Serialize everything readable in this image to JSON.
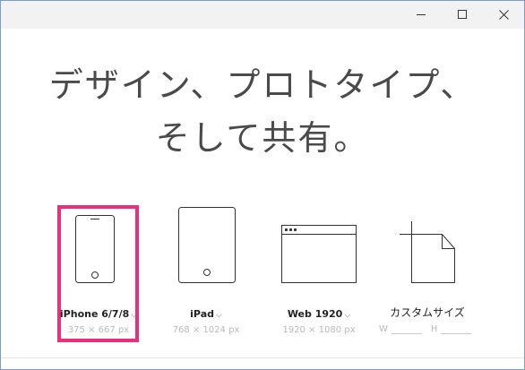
{
  "window": {
    "controls": {
      "minimize": "minimize-icon",
      "maximize": "maximize-icon",
      "close": "close-icon"
    }
  },
  "headline": {
    "line1": "デザイン、プロトタイプ、",
    "line2": "そして共有。"
  },
  "devices": [
    {
      "label": "iPhone 6/7/8",
      "size": "375 × 667 px",
      "selected": true,
      "icon": "iphone-icon"
    },
    {
      "label": "iPad",
      "size": "768 × 1024 px",
      "selected": false,
      "icon": "ipad-icon"
    },
    {
      "label": "Web 1920",
      "size": "1920 × 1080 px",
      "selected": false,
      "icon": "browser-window-icon"
    }
  ],
  "custom": {
    "label": "カスタムサイズ",
    "width_letter": "W",
    "height_letter": "H",
    "width_value": "",
    "height_value": "",
    "icon": "custom-document-icon"
  },
  "colors": {
    "selection": "#e8317c",
    "titlebar": "#f2f2f2",
    "window_border": "#7a9fc6"
  }
}
